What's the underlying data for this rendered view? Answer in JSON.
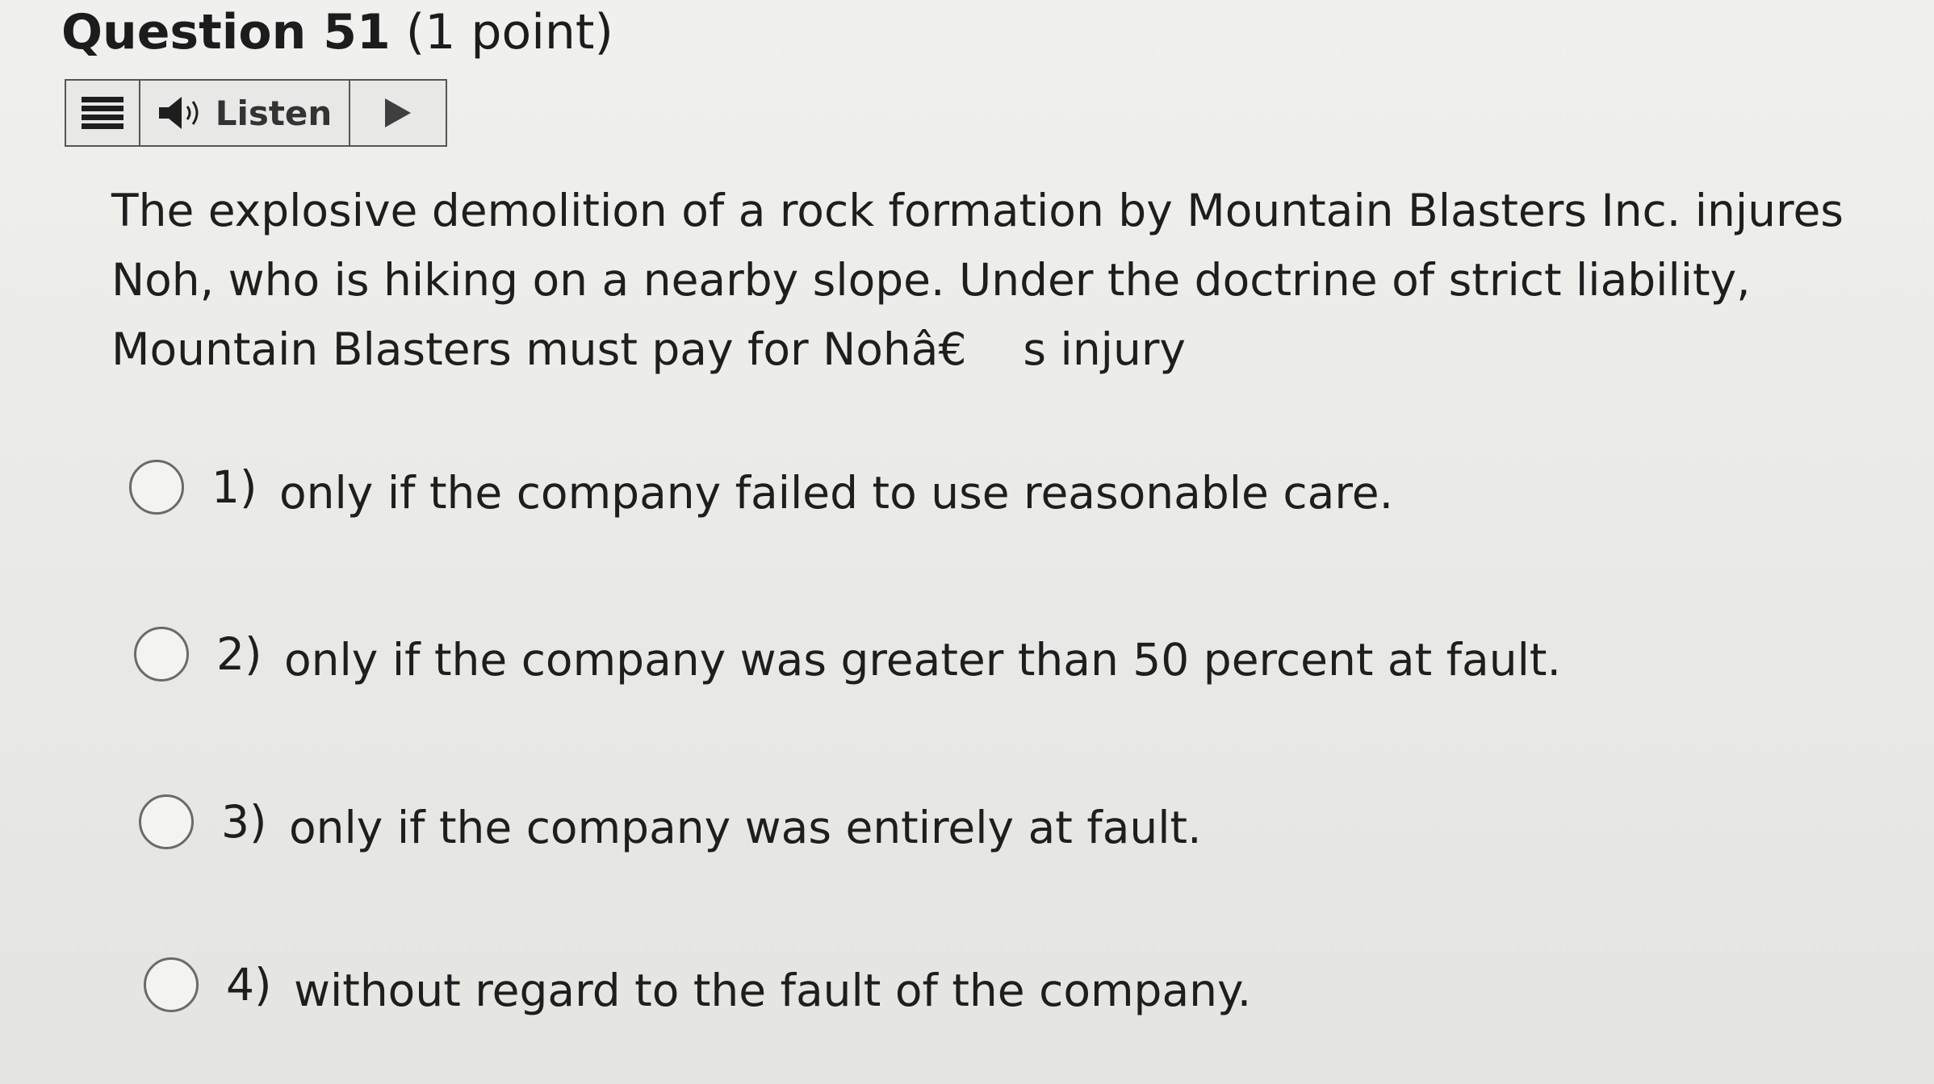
{
  "question": {
    "title": "Question 51",
    "points": "(1 point)"
  },
  "toolbar": {
    "menu_icon": "menu-icon",
    "listen_icon": "speaker-icon",
    "listen_label": "Listen",
    "play_icon": "play-icon"
  },
  "prompt": "The explosive demolition of a rock formation by Mountain Blasters Inc. injures Noh, who is hiking on a nearby slope. Under the doctrine of strict liability, Mountain Blasters must pay for Nohâ€    s injury",
  "options": [
    {
      "number": "1)",
      "text": "only if the company failed to use reasonable care."
    },
    {
      "number": "2)",
      "text": "only if the company was greater than 50 percent at fault."
    },
    {
      "number": "3)",
      "text": "only if the company was entirely at fault."
    },
    {
      "number": "4)",
      "text": "without regard to the fault of the company."
    }
  ],
  "colors": {
    "background": "#ebebe8",
    "text": "#1e1e1e",
    "border": "#555555",
    "play": "#3f3f3f"
  }
}
